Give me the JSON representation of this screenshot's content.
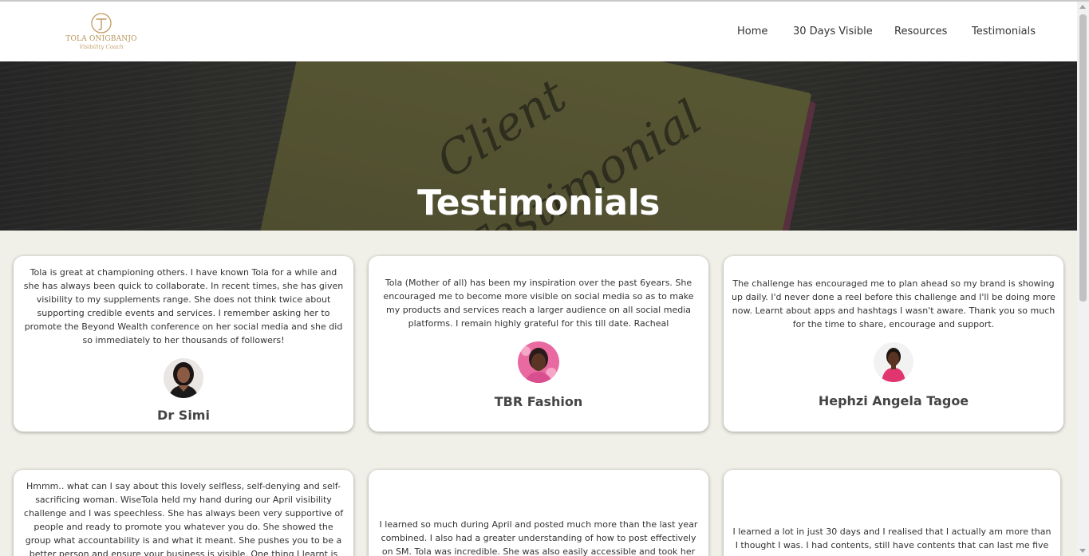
{
  "brand": {
    "name": "TOLA ONIGBANJO",
    "tagline": "Visibility Coach",
    "accent": "#b8935a"
  },
  "nav": {
    "items": [
      {
        "label": "Home"
      },
      {
        "label": "30 Days Visible"
      },
      {
        "label": "Resources"
      },
      {
        "label": "Testimonials"
      }
    ]
  },
  "hero": {
    "title": "Testimonials",
    "bg_script_1": "Client",
    "bg_script_2": "Testimonial"
  },
  "testimonials": [
    {
      "text": "Tola is great at championing others. I have known Tola for a while and she has always been quick to collaborate. In recent times, she has given visibility to my supplements range. She does not think twice about supporting credible events and services. I remember asking her to promote the Beyond Wealth conference on her social media and she did so immediately to her thousands of followers!",
      "name": "Dr Simi"
    },
    {
      "text": "Tola (Mother of all) has been my inspiration over the past 6years. She encouraged me to become more visible on social media so as to make my products and services reach a larger audience on all social media platforms. I remain highly grateful for this till date. Racheal",
      "name": "TBR Fashion"
    },
    {
      "text": "The challenge has encouraged me to plan ahead so my brand is showing up daily. I'd never done a reel before this challenge and I'll be doing more now. Learnt about apps and hashtags I wasn't aware. Thank you so much for the time to share, encourage and support.",
      "name": "Hephzi Angela Tagoe"
    },
    {
      "text": "Hmmm.. what can I say about this lovely selfless, self-denying and self-sacrificing woman. WiseTola held my hand during our April visibility challenge and I was speechless. She has always been very supportive of people and ready to promote you whatever you do. She showed the group what accountability is and what it meant. She pushes you to be a better person and ensure your business is visible. One thing I learnt is show up",
      "name": ""
    },
    {
      "text": "I learned so much during April and posted much more than the last year combined. I also had a greater understanding of how to post effectively on SM. Tola was incredible. She was also easily accessible and took her time to",
      "name": ""
    },
    {
      "text": "I learned a lot in just 30 days and I realised that I actually am more than I thought I was. I had contents, still have contents that can last me five years",
      "name": ""
    }
  ]
}
